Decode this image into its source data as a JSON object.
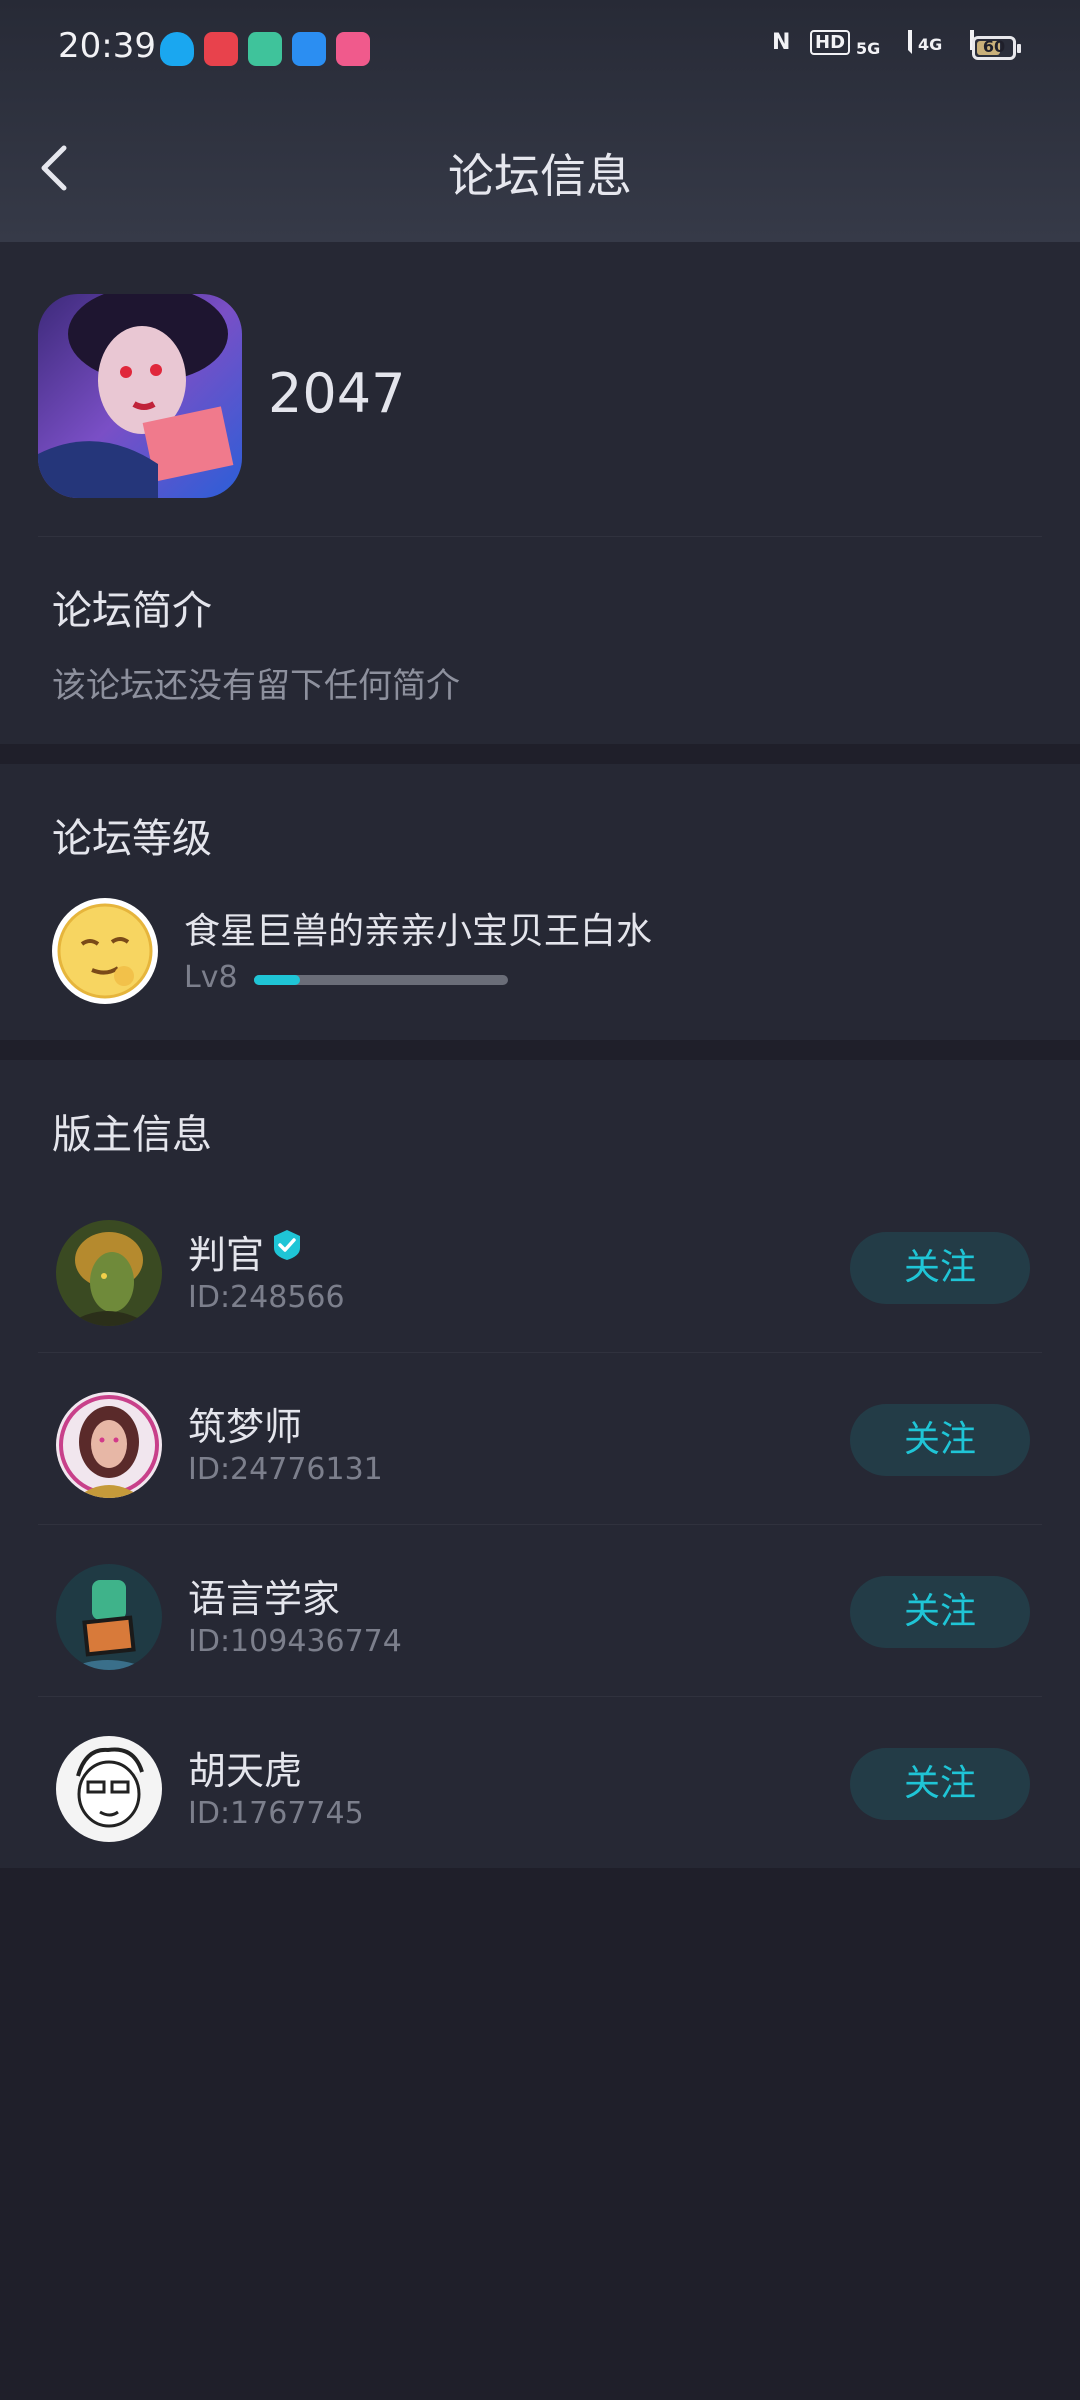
{
  "status_bar": {
    "time": "20:39",
    "notification_icons": [
      "qq-icon",
      "video-icon",
      "notes-icon",
      "browser-icon",
      "app-icon"
    ],
    "hd_label": "HD",
    "signal_5g": "5G",
    "signal_4g": "4G",
    "battery": "60"
  },
  "header": {
    "title": "论坛信息",
    "back_icon": "back-arrow-icon"
  },
  "forum": {
    "name": "2047",
    "icon": "forum-cover-image"
  },
  "intro": {
    "title": "论坛简介",
    "text": "该论坛还没有留下任何简介"
  },
  "level": {
    "title": "论坛等级",
    "name": "食星巨兽的亲亲小宝贝王白水",
    "lv": "Lv8",
    "progress": 0.18
  },
  "moderators": {
    "title": "版主信息",
    "follow_label": "关注",
    "items": [
      {
        "name": "判官",
        "id": "ID:248566",
        "verified": true
      },
      {
        "name": "筑梦师",
        "id": "ID:24776131",
        "verified": false
      },
      {
        "name": "语言学家",
        "id": "ID:109436774",
        "verified": false
      },
      {
        "name": "胡天虎",
        "id": "ID:1767745",
        "verified": false
      }
    ]
  },
  "colors": {
    "accent": "#1fc5d6",
    "follow_bg": "#233c47",
    "card_bg": "#262834",
    "page_bg": "#1f1f2a"
  }
}
